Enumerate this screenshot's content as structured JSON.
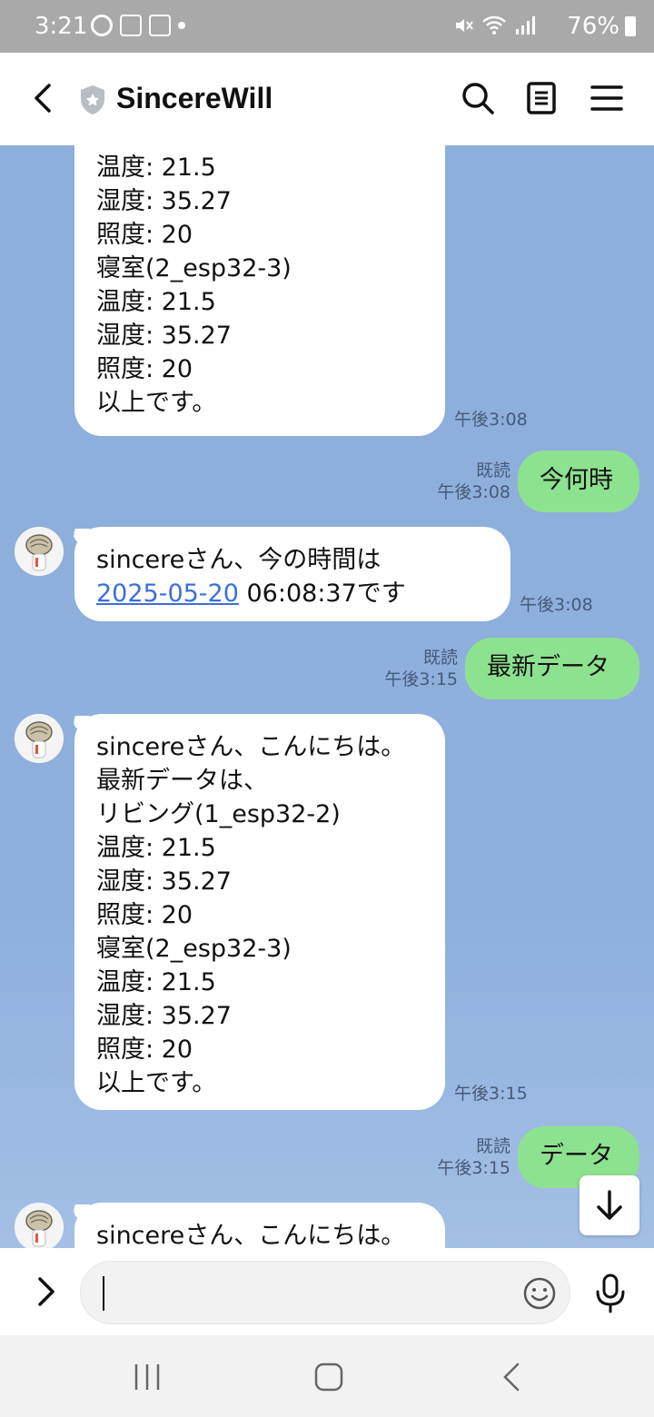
{
  "status_bar": {
    "time": "3:21",
    "battery": "76%"
  },
  "header": {
    "title": "SincereWill"
  },
  "messages": {
    "m1_lines": [
      "温度: 21.5",
      "湿度: 35.27",
      "照度: 20",
      "寝室(2_esp32-3)",
      "温度: 21.5",
      "湿度: 35.27",
      "照度: 20",
      "以上です。"
    ],
    "m1_time": "午後3:08",
    "m2_text": "今何時",
    "m2_read": "既読",
    "m2_time": "午後3:08",
    "m3_line1": "sincereさん、今の時間は",
    "m3_date": "2025-05-20",
    "m3_rest": " 06:08:37です",
    "m3_time": "午後3:08",
    "m4_text": "最新データ",
    "m4_read": "既読",
    "m4_time": "午後3:15",
    "m5_lines": [
      "sincereさん、こんにちは。",
      "最新データは、",
      "リビング(1_esp32-2)",
      "温度: 21.5",
      "湿度: 35.27",
      "照度: 20",
      "寝室(2_esp32-3)",
      "温度: 21.5",
      "湿度: 35.27",
      "照度: 20",
      "以上です。"
    ],
    "m5_time": "午後3:15",
    "m6_text": "データ",
    "m6_read": "既読",
    "m6_time": "午後3:15",
    "m7_text": "sincereさん、こんにちは。"
  },
  "input": {
    "placeholder": ""
  },
  "colors": {
    "chat_bg": "#8eaedc",
    "sent_bubble": "#8de28f",
    "received_bubble": "#ffffff",
    "link": "#3c6fd8"
  }
}
